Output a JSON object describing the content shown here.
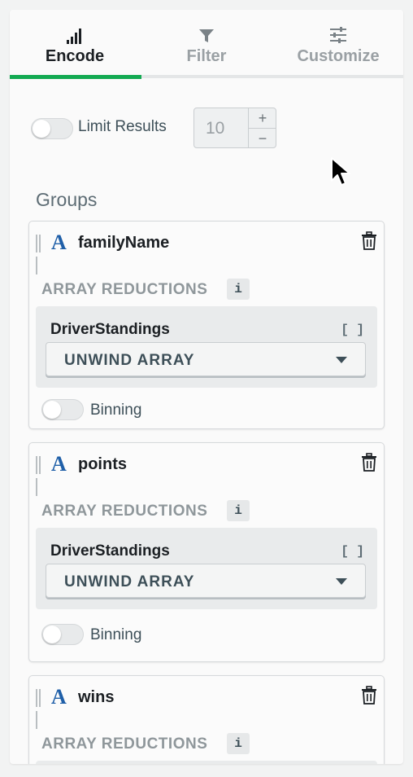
{
  "tabs": [
    {
      "label": "Encode",
      "icon": "signal-bars-icon",
      "active": true
    },
    {
      "label": "Filter",
      "icon": "funnel-icon",
      "active": false
    },
    {
      "label": "Customize",
      "icon": "sliders-icon",
      "active": false
    }
  ],
  "limit": {
    "label": "Limit Results",
    "enabled": false,
    "value": "10",
    "increment": "+",
    "decrement": "−"
  },
  "groups": {
    "title": "Groups",
    "cards": [
      {
        "field": "familyName",
        "type_glyph": "A",
        "reductions_label": "ARRAY REDUCTIONS",
        "info": "i",
        "array_name": "DriverStandings",
        "bracket": "[ ]",
        "reduction": "UNWIND ARRAY",
        "binning_label": "Binning"
      },
      {
        "field": "points",
        "type_glyph": "A",
        "reductions_label": "ARRAY REDUCTIONS",
        "info": "i",
        "array_name": "DriverStandings",
        "bracket": "[ ]",
        "reduction": "UNWIND ARRAY",
        "binning_label": "Binning"
      },
      {
        "field": "wins",
        "type_glyph": "A",
        "reductions_label": "ARRAY REDUCTIONS",
        "info": "i"
      }
    ]
  },
  "colors": {
    "active_tab_underline": "#13aa52",
    "type_icon": "#1f5fa8"
  }
}
